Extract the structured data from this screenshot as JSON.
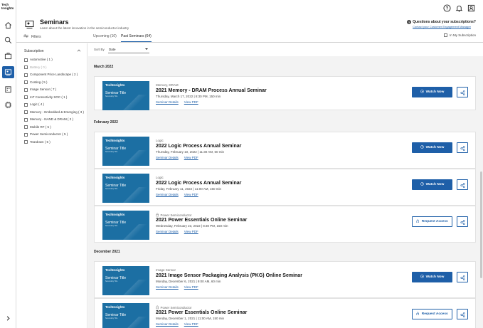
{
  "app": {
    "logo_text": "Tech Insights"
  },
  "header": {
    "title": "Seminars",
    "subtitle": "Learn about the latest innovation in the semiconductor industry",
    "questions_title": "Questions about your subscriptions?",
    "questions_link": "Contact your Customer Engagement Manager"
  },
  "tabs": {
    "filters_label": "Filters",
    "upcoming": "Upcoming (10)",
    "past": "Past Seminars (64)",
    "in_my_subscription": "In My Subscription"
  },
  "sidebar_filters": {
    "heading": "Subscription",
    "items": [
      {
        "label": "Automotive ( 1 )",
        "disabled": false
      },
      {
        "label": "Battery ( 0 )",
        "disabled": true
      },
      {
        "label": "Component Price Landscape ( 2 )",
        "disabled": false
      },
      {
        "label": "Costing ( 5 )",
        "disabled": false
      },
      {
        "label": "Image Sensor ( 7 )",
        "disabled": false
      },
      {
        "label": "IoT Connectivity SOC ( 1 )",
        "disabled": false
      },
      {
        "label": "Logic ( 4 )",
        "disabled": false
      },
      {
        "label": "Memory - Embedded & Emerging ( 3 )",
        "disabled": false
      },
      {
        "label": "Memory - NAND & DRAM ( 2 )",
        "disabled": false
      },
      {
        "label": "Mobile RF ( 5 )",
        "disabled": false
      },
      {
        "label": "Power Semiconductor ( 5 )",
        "disabled": false
      },
      {
        "label": "Teardown ( 5 )",
        "disabled": false
      }
    ]
  },
  "sort": {
    "label": "Sort By",
    "value": "Date"
  },
  "thumb": {
    "logo": "TechInsights",
    "title": "Seminar Title",
    "subtitle": "Secondary Title"
  },
  "actions": {
    "watch": "Watch Now",
    "request": "Request Access",
    "details": "Seminar Details",
    "pdf": "View PDF"
  },
  "months": [
    "March 2022",
    "February 2022",
    "December 2021"
  ],
  "seminars": [
    {
      "category": "Memory, DRAM",
      "title": "2021 Memory - DRAM Process Annual Seminar",
      "date": "Thursday, March 17, 2022 | 8:30 PM, 150 min",
      "locked": false
    },
    {
      "category": "Logic",
      "title": "2022 Logic Process Annual Seminar",
      "date": "Thursday, February 10, 2022 | 11:30 AM, 60 min",
      "locked": false
    },
    {
      "category": "Logic",
      "title": "2022 Logic Process Annual Seminar",
      "date": "Friday, February 11, 2022 | 11:00 AM, 150 min",
      "locked": false
    },
    {
      "category": "Power Semiconductor",
      "title": "2021 Power Essentials Online Seminar",
      "date": "Wednesday, February 23, 2022 | 8:30 PM, 150 min",
      "locked": true
    },
    {
      "category": "Image Sensor",
      "title": "2021 Image Sensor Packaging Analysis (PKG) Online Seminar",
      "date": "Monday, December 6, 2021 | 9:00 AM, 60 min",
      "locked": false
    },
    {
      "category": "Power Semiconductor",
      "title": "2021 Power Essentials Online Seminar",
      "date": "Monday, December 1, 2021 | 11:00 AM, 150 min",
      "locked": true
    }
  ]
}
